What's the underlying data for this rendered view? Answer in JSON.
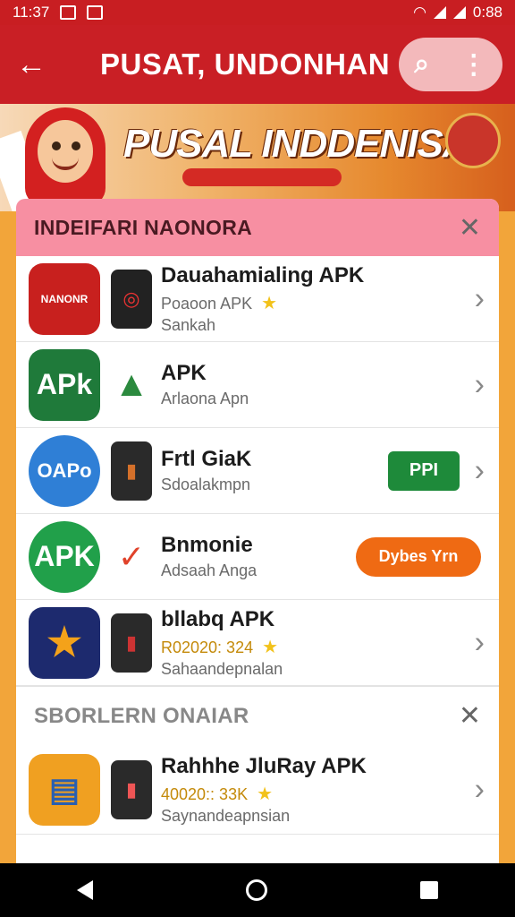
{
  "status_bar": {
    "time": "11:37",
    "battery_text": "0:88"
  },
  "app_bar": {
    "title": "PUSAT, UNDONHAN",
    "back_icon": "arrow-left-icon",
    "search_icon": "search-icon",
    "menu_icon": "more-vert-icon"
  },
  "banner": {
    "title": "PUSAL INDDENISA"
  },
  "section1": {
    "label": "INDEIFARI NAONORA",
    "items": [
      {
        "name": "Dauahamialing APK",
        "sub": "Poaoon APK",
        "sub2": "Sankah",
        "has_star": true,
        "action": "chevron",
        "icon_text": "NANONR",
        "icon_color": "#c8201e"
      },
      {
        "name": "APK",
        "sub": "Arlaona Apn",
        "sub2": "",
        "has_star": false,
        "action": "chevron",
        "icon_text": "APk",
        "icon_color": "#1f7a3a"
      },
      {
        "name": "Frtl GiaK",
        "sub": "Sdoalakmpn",
        "sub2": "",
        "has_star": false,
        "action": "button-green",
        "button_label": "PPI",
        "icon_text": "OAPo",
        "icon_color": "#2f7fd6"
      },
      {
        "name": "Bnmonie",
        "sub": "Adsaah Anga",
        "sub2": "",
        "has_star": false,
        "action": "button-orange",
        "button_label": "Dybes Yrn",
        "icon_text": "APK",
        "icon_color": "#21a04a"
      },
      {
        "name": "bllabq APK",
        "sub": "R02020: 324",
        "sub2": "Sahaandepnalan",
        "has_star": true,
        "action": "chevron",
        "icon_text": "★",
        "icon_color": "#1d2a6e"
      }
    ]
  },
  "section2": {
    "label": "SBORLERN ONAIAR",
    "items": [
      {
        "name": "Rahhhe JluRay APK",
        "sub": "40020:: 33K",
        "sub2": "Saynandeapnsian",
        "has_star": true,
        "action": "chevron",
        "icon_text": "▤",
        "icon_color": "#f0a021"
      }
    ]
  }
}
